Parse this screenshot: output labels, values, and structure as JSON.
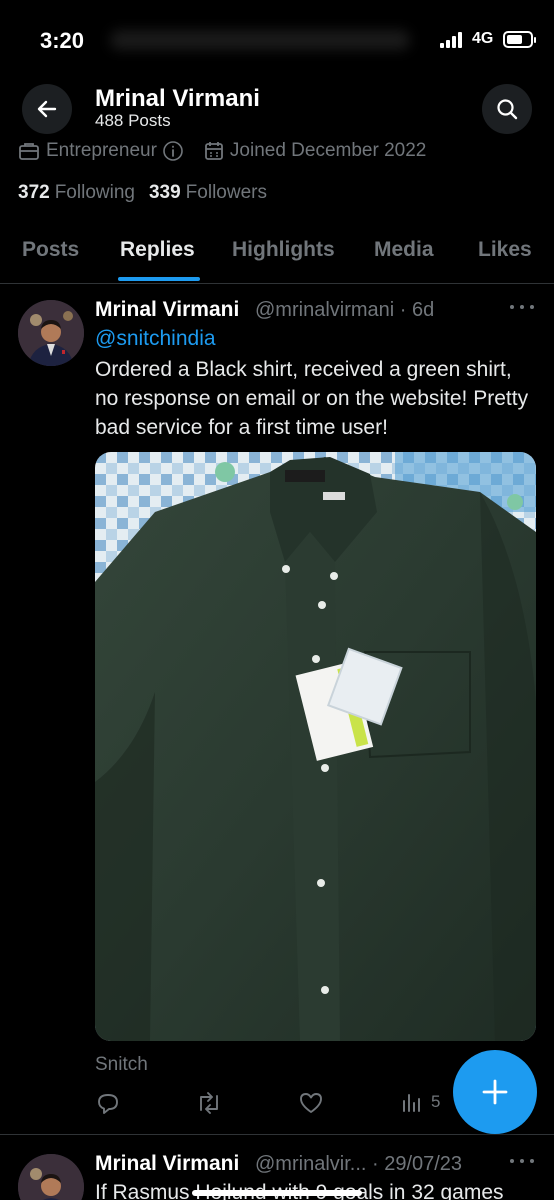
{
  "status_bar": {
    "time": "3:20",
    "network": "4G",
    "battery_level": 0.7
  },
  "header": {
    "name": "Mrinal Virmani",
    "posts": "488 Posts",
    "back_icon": "arrow-left-icon",
    "search_icon": "search-icon"
  },
  "profile": {
    "profession": "Entrepreneur",
    "joined": "Joined December 2022",
    "following_count": "372",
    "following_label": "Following",
    "followers_count": "339",
    "followers_label": "Followers"
  },
  "tabs": [
    {
      "label": "Posts",
      "active": false
    },
    {
      "label": "Replies",
      "active": true
    },
    {
      "label": "Highlights",
      "active": false
    },
    {
      "label": "Media",
      "active": false
    },
    {
      "label": "Likes",
      "active": false
    }
  ],
  "accent_color": "#1d9bf0",
  "tweet": {
    "name": "Mrinal Virmani",
    "handle": "@mrinalvirmani · 6d",
    "mention": "@snitchindia",
    "text": "Ordered a Black shirt, received a green shirt, no response on email or on the website! Pretty bad service for a first time user!",
    "image_caption": "Snitch",
    "views": "5"
  },
  "tweet2": {
    "name": "Mrinal Virmani",
    "handle": "@mrinalvir... · 29/07/23",
    "text": "If Rasmus Hojlund with 9 goals in 32 games"
  }
}
